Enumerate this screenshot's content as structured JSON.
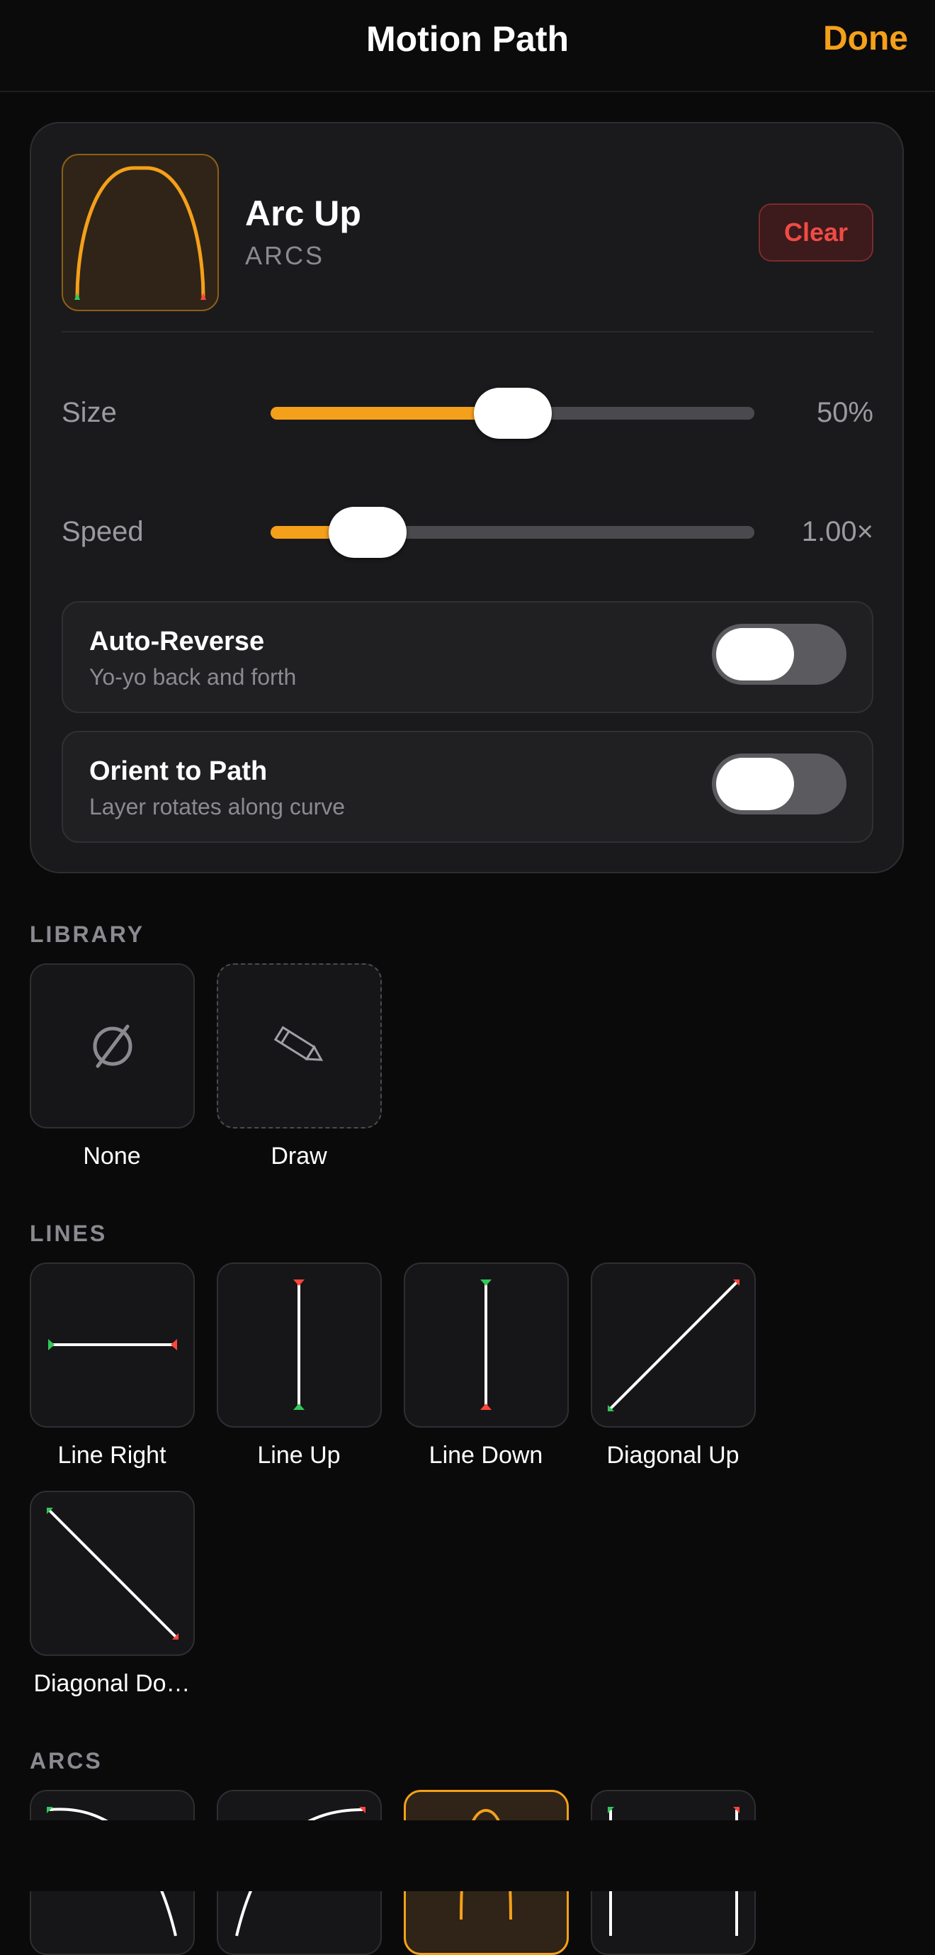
{
  "header": {
    "title": "Motion Path",
    "done_label": "Done"
  },
  "selected": {
    "name": "Arc Up",
    "category": "ARCS",
    "clear_label": "Clear",
    "size": {
      "label": "Size",
      "value_text": "50%",
      "fraction": 0.5
    },
    "speed": {
      "label": "Speed",
      "value_text": "1.00×",
      "fraction": 0.2
    },
    "toggles": [
      {
        "title": "Auto-Reverse",
        "subtitle": "Yo-yo back and forth",
        "on": false
      },
      {
        "title": "Orient to Path",
        "subtitle": "Layer rotates along curve",
        "on": false
      }
    ]
  },
  "library": {
    "title": "LIBRARY",
    "items": [
      {
        "label": "None",
        "icon": "empty-set-icon"
      },
      {
        "label": "Draw",
        "icon": "pencil-icon"
      }
    ]
  },
  "lines": {
    "title": "LINES",
    "items": [
      {
        "label": "Line Right",
        "icon": "line-right-icon"
      },
      {
        "label": "Line Up",
        "icon": "line-up-icon"
      },
      {
        "label": "Line Down",
        "icon": "line-down-icon"
      },
      {
        "label": "Diagonal Up",
        "icon": "diagonal-up-icon"
      },
      {
        "label": "Diagonal Do…",
        "icon": "diagonal-down-icon"
      }
    ]
  },
  "arcs": {
    "title": "ARCS",
    "items": [
      {
        "icon": "arc-down-right-icon"
      },
      {
        "icon": "arc-up-right-icon"
      },
      {
        "icon": "arc-up-icon",
        "selected": true
      },
      {
        "icon": "arc-bracket-icon"
      }
    ]
  },
  "colors": {
    "accent": "#f5a01a",
    "start_marker": "#34c759",
    "end_marker": "#ff453a",
    "destructive": "#ef4b45"
  }
}
